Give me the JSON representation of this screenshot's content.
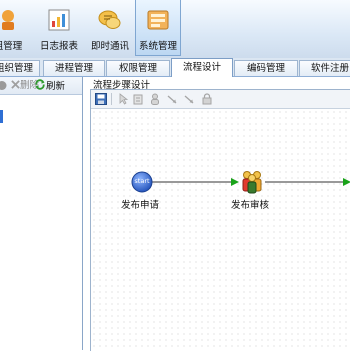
{
  "ribbon": {
    "items": [
      {
        "label": "组管理",
        "icon": "org-tree-icon"
      },
      {
        "label": "日志报表",
        "icon": "report-chart-icon"
      },
      {
        "label": "即时通讯",
        "icon": "chat-messages-icon"
      },
      {
        "label": "系统管理",
        "icon": "system-settings-icon"
      }
    ]
  },
  "tabs": [
    "组织管理",
    "进程管理",
    "权限管理",
    "流程设计",
    "编码管理",
    "软件注册"
  ],
  "active_tab": "流程设计",
  "left_toolbar": {
    "delete_label": "删除",
    "refresh_label": "刷新"
  },
  "designer": {
    "title": "流程步骤设计",
    "nodes": {
      "start_badge": "start",
      "start_label": "发布申请",
      "review_label": "发布审核"
    }
  },
  "colors": {
    "ribbon_border": "#9cb3cf",
    "active_accent": "#2f6fd4",
    "arrow_green": "#1aa31a",
    "start_blue": "#2f63c7"
  }
}
